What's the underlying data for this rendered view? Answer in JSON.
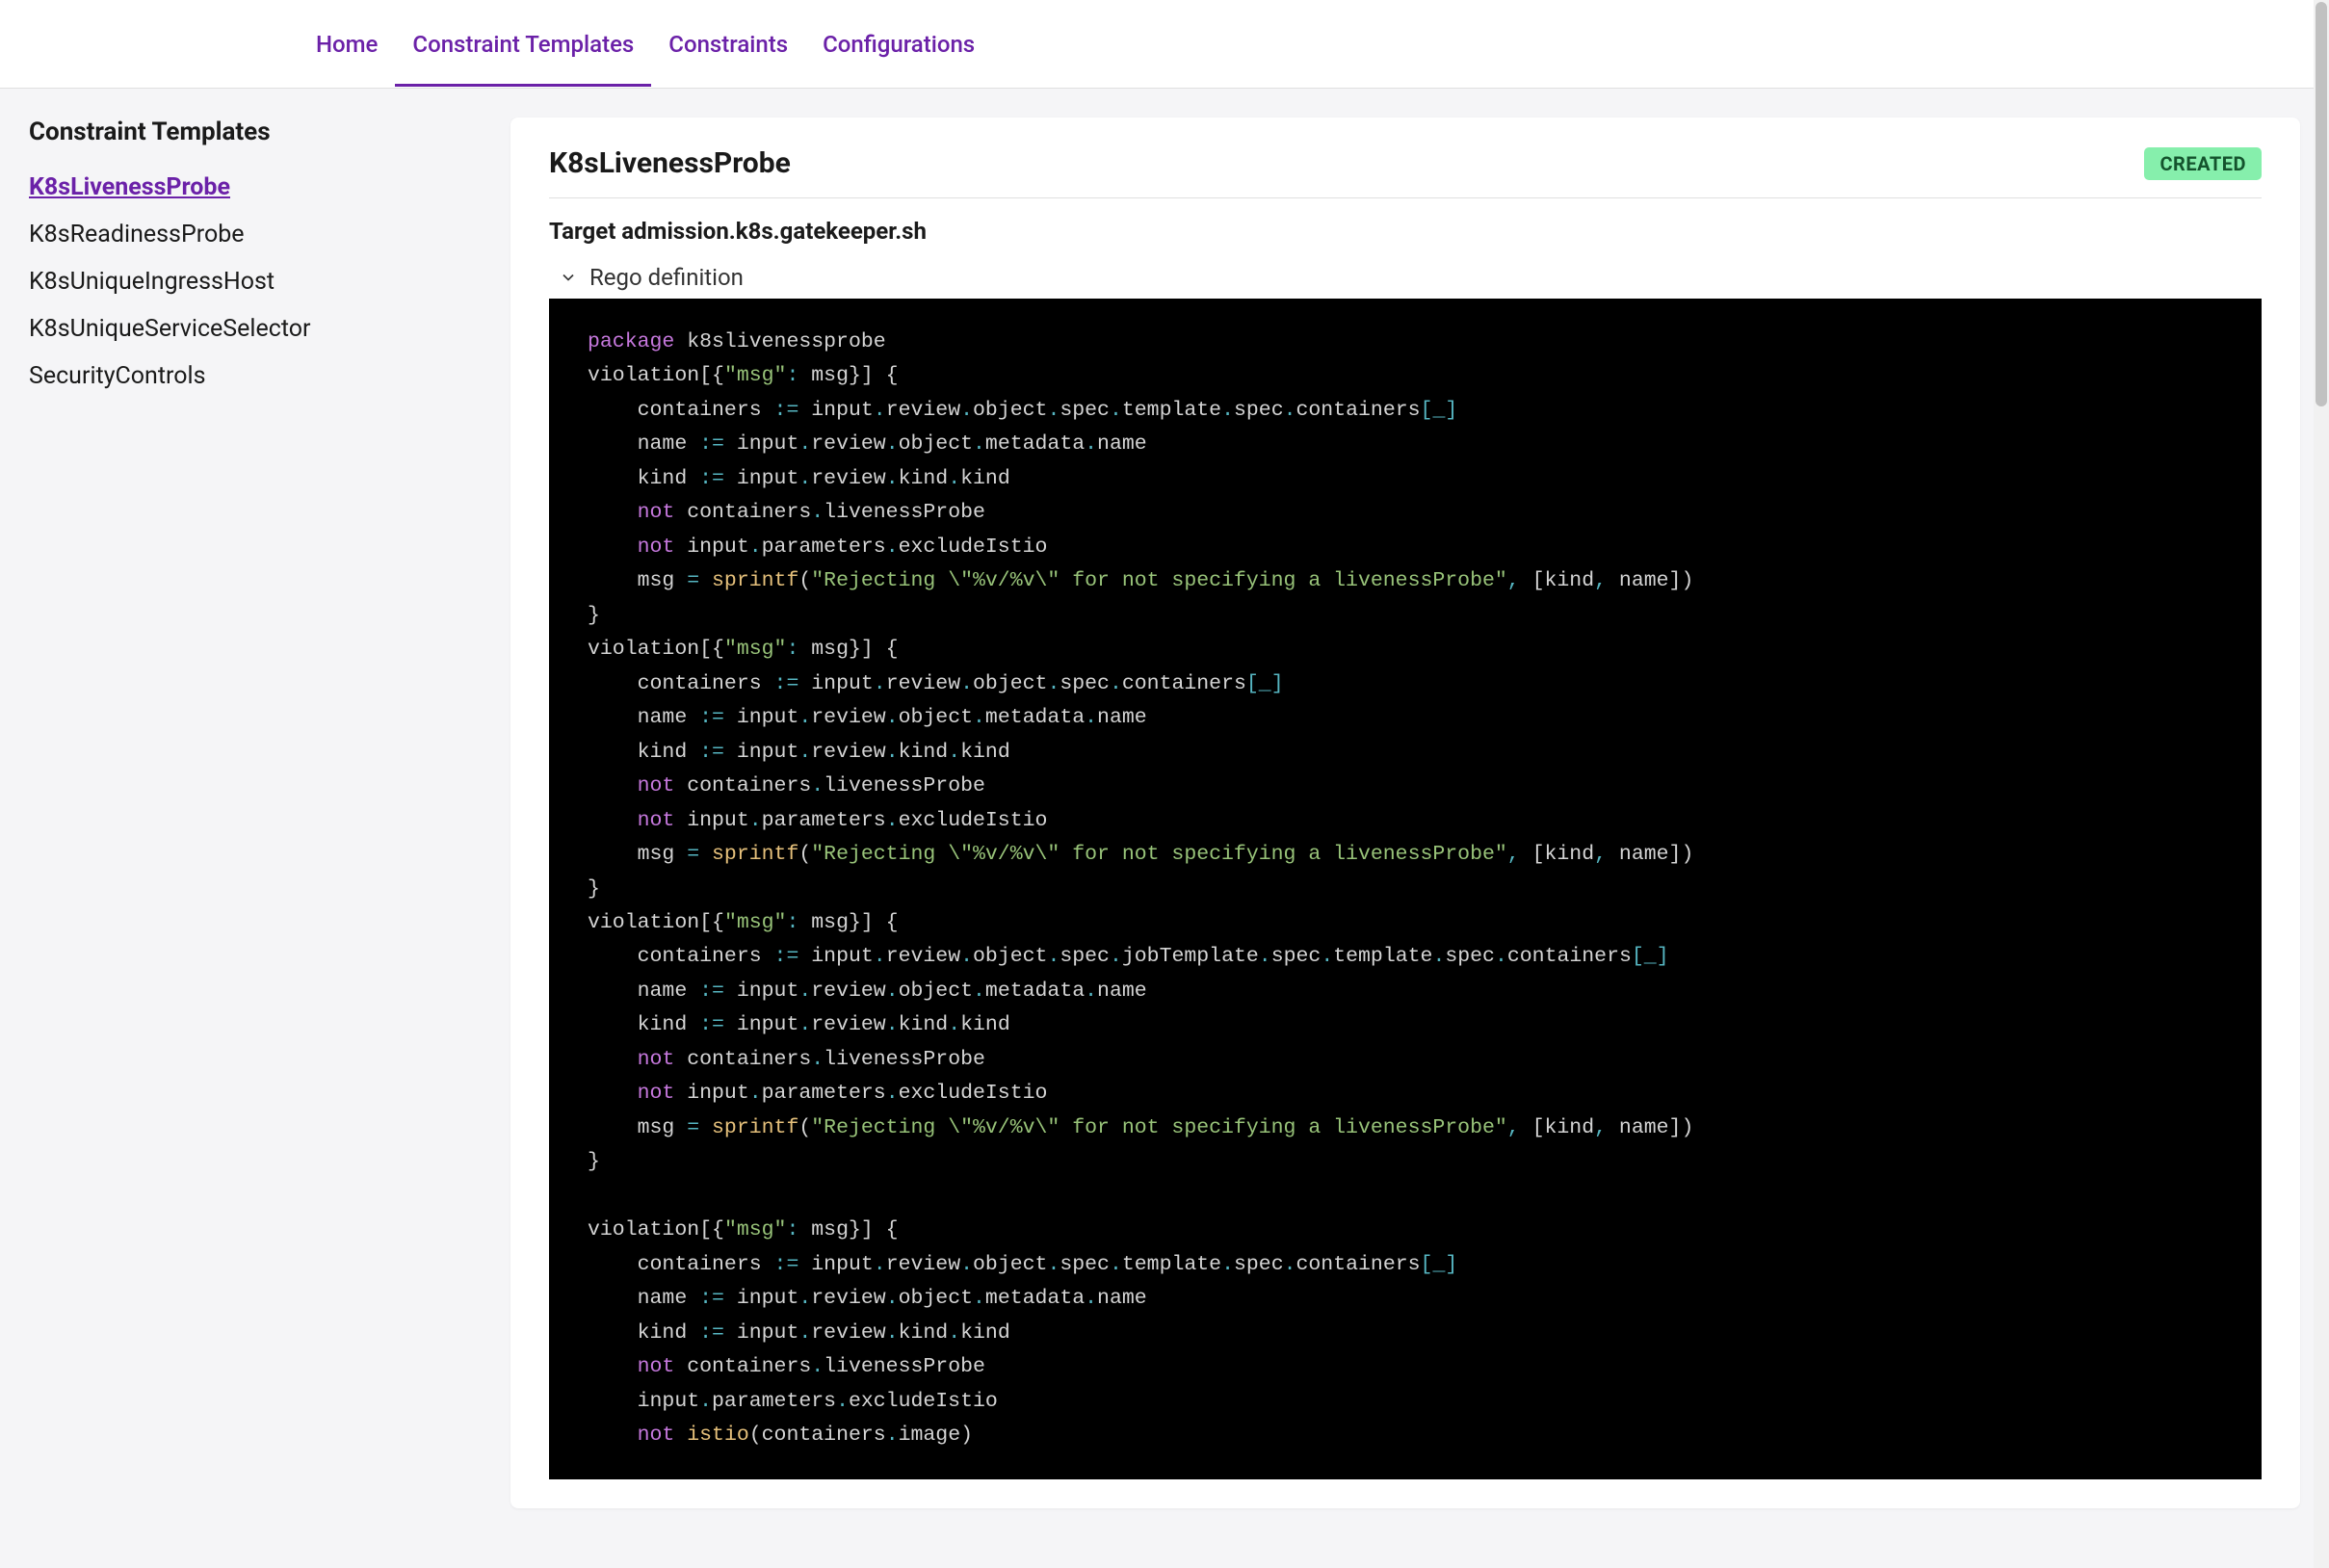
{
  "nav": {
    "items": [
      {
        "label": "Home",
        "active": false
      },
      {
        "label": "Constraint Templates",
        "active": true
      },
      {
        "label": "Constraints",
        "active": false
      },
      {
        "label": "Configurations",
        "active": false
      }
    ]
  },
  "sidebar": {
    "title": "Constraint Templates",
    "items": [
      {
        "label": "K8sLivenessProbe",
        "active": true
      },
      {
        "label": "K8sReadinessProbe",
        "active": false
      },
      {
        "label": "K8sUniqueIngressHost",
        "active": false
      },
      {
        "label": "K8sUniqueServiceSelector",
        "active": false
      },
      {
        "label": "SecurityControls",
        "active": false
      }
    ]
  },
  "main": {
    "title": "K8sLivenessProbe",
    "status": "CREATED",
    "target_label": "Target",
    "target_value": "admission.k8s.gatekeeper.sh",
    "section_label": "Rego definition",
    "code": [
      [
        {
          "t": "package",
          "c": "keyword"
        },
        {
          "t": " k8slivenessprobe",
          "c": "plain"
        }
      ],
      [
        {
          "t": "violation[{",
          "c": "plain"
        },
        {
          "t": "\"msg\"",
          "c": "string"
        },
        {
          "t": ":",
          "c": "op"
        },
        {
          "t": " msg",
          "c": "plain"
        },
        {
          "t": "}",
          "c": "plain"
        },
        {
          "t": "] {",
          "c": "plain"
        }
      ],
      [
        {
          "t": "    containers ",
          "c": "plain"
        },
        {
          "t": ":=",
          "c": "op"
        },
        {
          "t": " input",
          "c": "plain"
        },
        {
          "t": ".",
          "c": "punct"
        },
        {
          "t": "review",
          "c": "plain"
        },
        {
          "t": ".",
          "c": "punct"
        },
        {
          "t": "object",
          "c": "plain"
        },
        {
          "t": ".",
          "c": "punct"
        },
        {
          "t": "spec",
          "c": "plain"
        },
        {
          "t": ".",
          "c": "punct"
        },
        {
          "t": "template",
          "c": "plain"
        },
        {
          "t": ".",
          "c": "punct"
        },
        {
          "t": "spec",
          "c": "plain"
        },
        {
          "t": ".",
          "c": "punct"
        },
        {
          "t": "containers",
          "c": "plain"
        },
        {
          "t": "[",
          "c": "punct"
        },
        {
          "t": "_",
          "c": "under"
        },
        {
          "t": "]",
          "c": "punct"
        }
      ],
      [
        {
          "t": "    name ",
          "c": "plain"
        },
        {
          "t": ":=",
          "c": "op"
        },
        {
          "t": " input",
          "c": "plain"
        },
        {
          "t": ".",
          "c": "punct"
        },
        {
          "t": "review",
          "c": "plain"
        },
        {
          "t": ".",
          "c": "punct"
        },
        {
          "t": "object",
          "c": "plain"
        },
        {
          "t": ".",
          "c": "punct"
        },
        {
          "t": "metadata",
          "c": "plain"
        },
        {
          "t": ".",
          "c": "punct"
        },
        {
          "t": "name",
          "c": "plain"
        }
      ],
      [
        {
          "t": "    kind ",
          "c": "plain"
        },
        {
          "t": ":=",
          "c": "op"
        },
        {
          "t": " input",
          "c": "plain"
        },
        {
          "t": ".",
          "c": "punct"
        },
        {
          "t": "review",
          "c": "plain"
        },
        {
          "t": ".",
          "c": "punct"
        },
        {
          "t": "kind",
          "c": "plain"
        },
        {
          "t": ".",
          "c": "punct"
        },
        {
          "t": "kind",
          "c": "plain"
        }
      ],
      [
        {
          "t": "    ",
          "c": "plain"
        },
        {
          "t": "not",
          "c": "keyword"
        },
        {
          "t": " containers",
          "c": "plain"
        },
        {
          "t": ".",
          "c": "punct"
        },
        {
          "t": "livenessProbe",
          "c": "plain"
        }
      ],
      [
        {
          "t": "    ",
          "c": "plain"
        },
        {
          "t": "not",
          "c": "keyword"
        },
        {
          "t": " input",
          "c": "plain"
        },
        {
          "t": ".",
          "c": "punct"
        },
        {
          "t": "parameters",
          "c": "plain"
        },
        {
          "t": ".",
          "c": "punct"
        },
        {
          "t": "excludeIstio",
          "c": "plain"
        }
      ],
      [
        {
          "t": "    msg ",
          "c": "plain"
        },
        {
          "t": "=",
          "c": "op"
        },
        {
          "t": " ",
          "c": "plain"
        },
        {
          "t": "sprintf",
          "c": "func"
        },
        {
          "t": "(",
          "c": "plain"
        },
        {
          "t": "\"Rejecting \\\"%v/%v\\\" for not specifying a livenessProbe\"",
          "c": "string"
        },
        {
          "t": ",",
          "c": "punct"
        },
        {
          "t": " [kind",
          "c": "plain"
        },
        {
          "t": ",",
          "c": "punct"
        },
        {
          "t": " name])",
          "c": "plain"
        }
      ],
      [
        {
          "t": "}",
          "c": "plain"
        }
      ],
      [
        {
          "t": "violation[{",
          "c": "plain"
        },
        {
          "t": "\"msg\"",
          "c": "string"
        },
        {
          "t": ":",
          "c": "op"
        },
        {
          "t": " msg",
          "c": "plain"
        },
        {
          "t": "}",
          "c": "plain"
        },
        {
          "t": "] {",
          "c": "plain"
        }
      ],
      [
        {
          "t": "    containers ",
          "c": "plain"
        },
        {
          "t": ":=",
          "c": "op"
        },
        {
          "t": " input",
          "c": "plain"
        },
        {
          "t": ".",
          "c": "punct"
        },
        {
          "t": "review",
          "c": "plain"
        },
        {
          "t": ".",
          "c": "punct"
        },
        {
          "t": "object",
          "c": "plain"
        },
        {
          "t": ".",
          "c": "punct"
        },
        {
          "t": "spec",
          "c": "plain"
        },
        {
          "t": ".",
          "c": "punct"
        },
        {
          "t": "containers",
          "c": "plain"
        },
        {
          "t": "[",
          "c": "punct"
        },
        {
          "t": "_",
          "c": "under"
        },
        {
          "t": "]",
          "c": "punct"
        }
      ],
      [
        {
          "t": "    name ",
          "c": "plain"
        },
        {
          "t": ":=",
          "c": "op"
        },
        {
          "t": " input",
          "c": "plain"
        },
        {
          "t": ".",
          "c": "punct"
        },
        {
          "t": "review",
          "c": "plain"
        },
        {
          "t": ".",
          "c": "punct"
        },
        {
          "t": "object",
          "c": "plain"
        },
        {
          "t": ".",
          "c": "punct"
        },
        {
          "t": "metadata",
          "c": "plain"
        },
        {
          "t": ".",
          "c": "punct"
        },
        {
          "t": "name",
          "c": "plain"
        }
      ],
      [
        {
          "t": "    kind ",
          "c": "plain"
        },
        {
          "t": ":=",
          "c": "op"
        },
        {
          "t": " input",
          "c": "plain"
        },
        {
          "t": ".",
          "c": "punct"
        },
        {
          "t": "review",
          "c": "plain"
        },
        {
          "t": ".",
          "c": "punct"
        },
        {
          "t": "kind",
          "c": "plain"
        },
        {
          "t": ".",
          "c": "punct"
        },
        {
          "t": "kind",
          "c": "plain"
        }
      ],
      [
        {
          "t": "    ",
          "c": "plain"
        },
        {
          "t": "not",
          "c": "keyword"
        },
        {
          "t": " containers",
          "c": "plain"
        },
        {
          "t": ".",
          "c": "punct"
        },
        {
          "t": "livenessProbe",
          "c": "plain"
        }
      ],
      [
        {
          "t": "    ",
          "c": "plain"
        },
        {
          "t": "not",
          "c": "keyword"
        },
        {
          "t": " input",
          "c": "plain"
        },
        {
          "t": ".",
          "c": "punct"
        },
        {
          "t": "parameters",
          "c": "plain"
        },
        {
          "t": ".",
          "c": "punct"
        },
        {
          "t": "excludeIstio",
          "c": "plain"
        }
      ],
      [
        {
          "t": "    msg ",
          "c": "plain"
        },
        {
          "t": "=",
          "c": "op"
        },
        {
          "t": " ",
          "c": "plain"
        },
        {
          "t": "sprintf",
          "c": "func"
        },
        {
          "t": "(",
          "c": "plain"
        },
        {
          "t": "\"Rejecting \\\"%v/%v\\\" for not specifying a livenessProbe\"",
          "c": "string"
        },
        {
          "t": ",",
          "c": "punct"
        },
        {
          "t": " [kind",
          "c": "plain"
        },
        {
          "t": ",",
          "c": "punct"
        },
        {
          "t": " name])",
          "c": "plain"
        }
      ],
      [
        {
          "t": "}",
          "c": "plain"
        }
      ],
      [
        {
          "t": "violation[{",
          "c": "plain"
        },
        {
          "t": "\"msg\"",
          "c": "string"
        },
        {
          "t": ":",
          "c": "op"
        },
        {
          "t": " msg",
          "c": "plain"
        },
        {
          "t": "}",
          "c": "plain"
        },
        {
          "t": "] {",
          "c": "plain"
        }
      ],
      [
        {
          "t": "    containers ",
          "c": "plain"
        },
        {
          "t": ":=",
          "c": "op"
        },
        {
          "t": " input",
          "c": "plain"
        },
        {
          "t": ".",
          "c": "punct"
        },
        {
          "t": "review",
          "c": "plain"
        },
        {
          "t": ".",
          "c": "punct"
        },
        {
          "t": "object",
          "c": "plain"
        },
        {
          "t": ".",
          "c": "punct"
        },
        {
          "t": "spec",
          "c": "plain"
        },
        {
          "t": ".",
          "c": "punct"
        },
        {
          "t": "jobTemplate",
          "c": "plain"
        },
        {
          "t": ".",
          "c": "punct"
        },
        {
          "t": "spec",
          "c": "plain"
        },
        {
          "t": ".",
          "c": "punct"
        },
        {
          "t": "template",
          "c": "plain"
        },
        {
          "t": ".",
          "c": "punct"
        },
        {
          "t": "spec",
          "c": "plain"
        },
        {
          "t": ".",
          "c": "punct"
        },
        {
          "t": "containers",
          "c": "plain"
        },
        {
          "t": "[",
          "c": "punct"
        },
        {
          "t": "_",
          "c": "under"
        },
        {
          "t": "]",
          "c": "punct"
        }
      ],
      [
        {
          "t": "    name ",
          "c": "plain"
        },
        {
          "t": ":=",
          "c": "op"
        },
        {
          "t": " input",
          "c": "plain"
        },
        {
          "t": ".",
          "c": "punct"
        },
        {
          "t": "review",
          "c": "plain"
        },
        {
          "t": ".",
          "c": "punct"
        },
        {
          "t": "object",
          "c": "plain"
        },
        {
          "t": ".",
          "c": "punct"
        },
        {
          "t": "metadata",
          "c": "plain"
        },
        {
          "t": ".",
          "c": "punct"
        },
        {
          "t": "name",
          "c": "plain"
        }
      ],
      [
        {
          "t": "    kind ",
          "c": "plain"
        },
        {
          "t": ":=",
          "c": "op"
        },
        {
          "t": " input",
          "c": "plain"
        },
        {
          "t": ".",
          "c": "punct"
        },
        {
          "t": "review",
          "c": "plain"
        },
        {
          "t": ".",
          "c": "punct"
        },
        {
          "t": "kind",
          "c": "plain"
        },
        {
          "t": ".",
          "c": "punct"
        },
        {
          "t": "kind",
          "c": "plain"
        }
      ],
      [
        {
          "t": "    ",
          "c": "plain"
        },
        {
          "t": "not",
          "c": "keyword"
        },
        {
          "t": " containers",
          "c": "plain"
        },
        {
          "t": ".",
          "c": "punct"
        },
        {
          "t": "livenessProbe",
          "c": "plain"
        }
      ],
      [
        {
          "t": "    ",
          "c": "plain"
        },
        {
          "t": "not",
          "c": "keyword"
        },
        {
          "t": " input",
          "c": "plain"
        },
        {
          "t": ".",
          "c": "punct"
        },
        {
          "t": "parameters",
          "c": "plain"
        },
        {
          "t": ".",
          "c": "punct"
        },
        {
          "t": "excludeIstio",
          "c": "plain"
        }
      ],
      [
        {
          "t": "    msg ",
          "c": "plain"
        },
        {
          "t": "=",
          "c": "op"
        },
        {
          "t": " ",
          "c": "plain"
        },
        {
          "t": "sprintf",
          "c": "func"
        },
        {
          "t": "(",
          "c": "plain"
        },
        {
          "t": "\"Rejecting \\\"%v/%v\\\" for not specifying a livenessProbe\"",
          "c": "string"
        },
        {
          "t": ",",
          "c": "punct"
        },
        {
          "t": " [kind",
          "c": "plain"
        },
        {
          "t": ",",
          "c": "punct"
        },
        {
          "t": " name])",
          "c": "plain"
        }
      ],
      [
        {
          "t": "}",
          "c": "plain"
        }
      ],
      [
        {
          "t": "",
          "c": "plain"
        }
      ],
      [
        {
          "t": "violation[{",
          "c": "plain"
        },
        {
          "t": "\"msg\"",
          "c": "string"
        },
        {
          "t": ":",
          "c": "op"
        },
        {
          "t": " msg",
          "c": "plain"
        },
        {
          "t": "}",
          "c": "plain"
        },
        {
          "t": "] {",
          "c": "plain"
        }
      ],
      [
        {
          "t": "    containers ",
          "c": "plain"
        },
        {
          "t": ":=",
          "c": "op"
        },
        {
          "t": " input",
          "c": "plain"
        },
        {
          "t": ".",
          "c": "punct"
        },
        {
          "t": "review",
          "c": "plain"
        },
        {
          "t": ".",
          "c": "punct"
        },
        {
          "t": "object",
          "c": "plain"
        },
        {
          "t": ".",
          "c": "punct"
        },
        {
          "t": "spec",
          "c": "plain"
        },
        {
          "t": ".",
          "c": "punct"
        },
        {
          "t": "template",
          "c": "plain"
        },
        {
          "t": ".",
          "c": "punct"
        },
        {
          "t": "spec",
          "c": "plain"
        },
        {
          "t": ".",
          "c": "punct"
        },
        {
          "t": "containers",
          "c": "plain"
        },
        {
          "t": "[",
          "c": "punct"
        },
        {
          "t": "_",
          "c": "under"
        },
        {
          "t": "]",
          "c": "punct"
        }
      ],
      [
        {
          "t": "    name ",
          "c": "plain"
        },
        {
          "t": ":=",
          "c": "op"
        },
        {
          "t": " input",
          "c": "plain"
        },
        {
          "t": ".",
          "c": "punct"
        },
        {
          "t": "review",
          "c": "plain"
        },
        {
          "t": ".",
          "c": "punct"
        },
        {
          "t": "object",
          "c": "plain"
        },
        {
          "t": ".",
          "c": "punct"
        },
        {
          "t": "metadata",
          "c": "plain"
        },
        {
          "t": ".",
          "c": "punct"
        },
        {
          "t": "name",
          "c": "plain"
        }
      ],
      [
        {
          "t": "    kind ",
          "c": "plain"
        },
        {
          "t": ":=",
          "c": "op"
        },
        {
          "t": " input",
          "c": "plain"
        },
        {
          "t": ".",
          "c": "punct"
        },
        {
          "t": "review",
          "c": "plain"
        },
        {
          "t": ".",
          "c": "punct"
        },
        {
          "t": "kind",
          "c": "plain"
        },
        {
          "t": ".",
          "c": "punct"
        },
        {
          "t": "kind",
          "c": "plain"
        }
      ],
      [
        {
          "t": "    ",
          "c": "plain"
        },
        {
          "t": "not",
          "c": "keyword"
        },
        {
          "t": " containers",
          "c": "plain"
        },
        {
          "t": ".",
          "c": "punct"
        },
        {
          "t": "livenessProbe",
          "c": "plain"
        }
      ],
      [
        {
          "t": "    input",
          "c": "plain"
        },
        {
          "t": ".",
          "c": "punct"
        },
        {
          "t": "parameters",
          "c": "plain"
        },
        {
          "t": ".",
          "c": "punct"
        },
        {
          "t": "excludeIstio",
          "c": "plain"
        }
      ],
      [
        {
          "t": "    ",
          "c": "plain"
        },
        {
          "t": "not",
          "c": "keyword"
        },
        {
          "t": " ",
          "c": "plain"
        },
        {
          "t": "istio",
          "c": "func"
        },
        {
          "t": "(containers",
          "c": "plain"
        },
        {
          "t": ".",
          "c": "punct"
        },
        {
          "t": "image)",
          "c": "plain"
        }
      ]
    ]
  }
}
